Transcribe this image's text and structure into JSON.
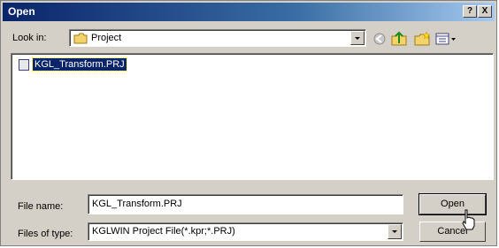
{
  "window": {
    "title": "Open",
    "help_label": "?",
    "close_label": "X"
  },
  "lookin": {
    "label": "Look in:",
    "value": "Project"
  },
  "toolbar": {
    "icons": [
      "back-icon",
      "up-folder-icon",
      "new-folder-icon",
      "view-menu-icon"
    ]
  },
  "files": [
    {
      "name": "KGL_Transform.PRJ",
      "selected": true
    }
  ],
  "filename": {
    "label": "File name:",
    "value": "KGL_Transform.PRJ"
  },
  "filetype": {
    "label": "Files of type:",
    "value": "KGLWIN Project File(*.kpr;*.PRJ)"
  },
  "buttons": {
    "open": "Open",
    "cancel": "Cancel"
  },
  "colors": {
    "titlebar": "#0a246a",
    "dialog_bg": "#d4d0c8",
    "selection": "#0a246a"
  }
}
